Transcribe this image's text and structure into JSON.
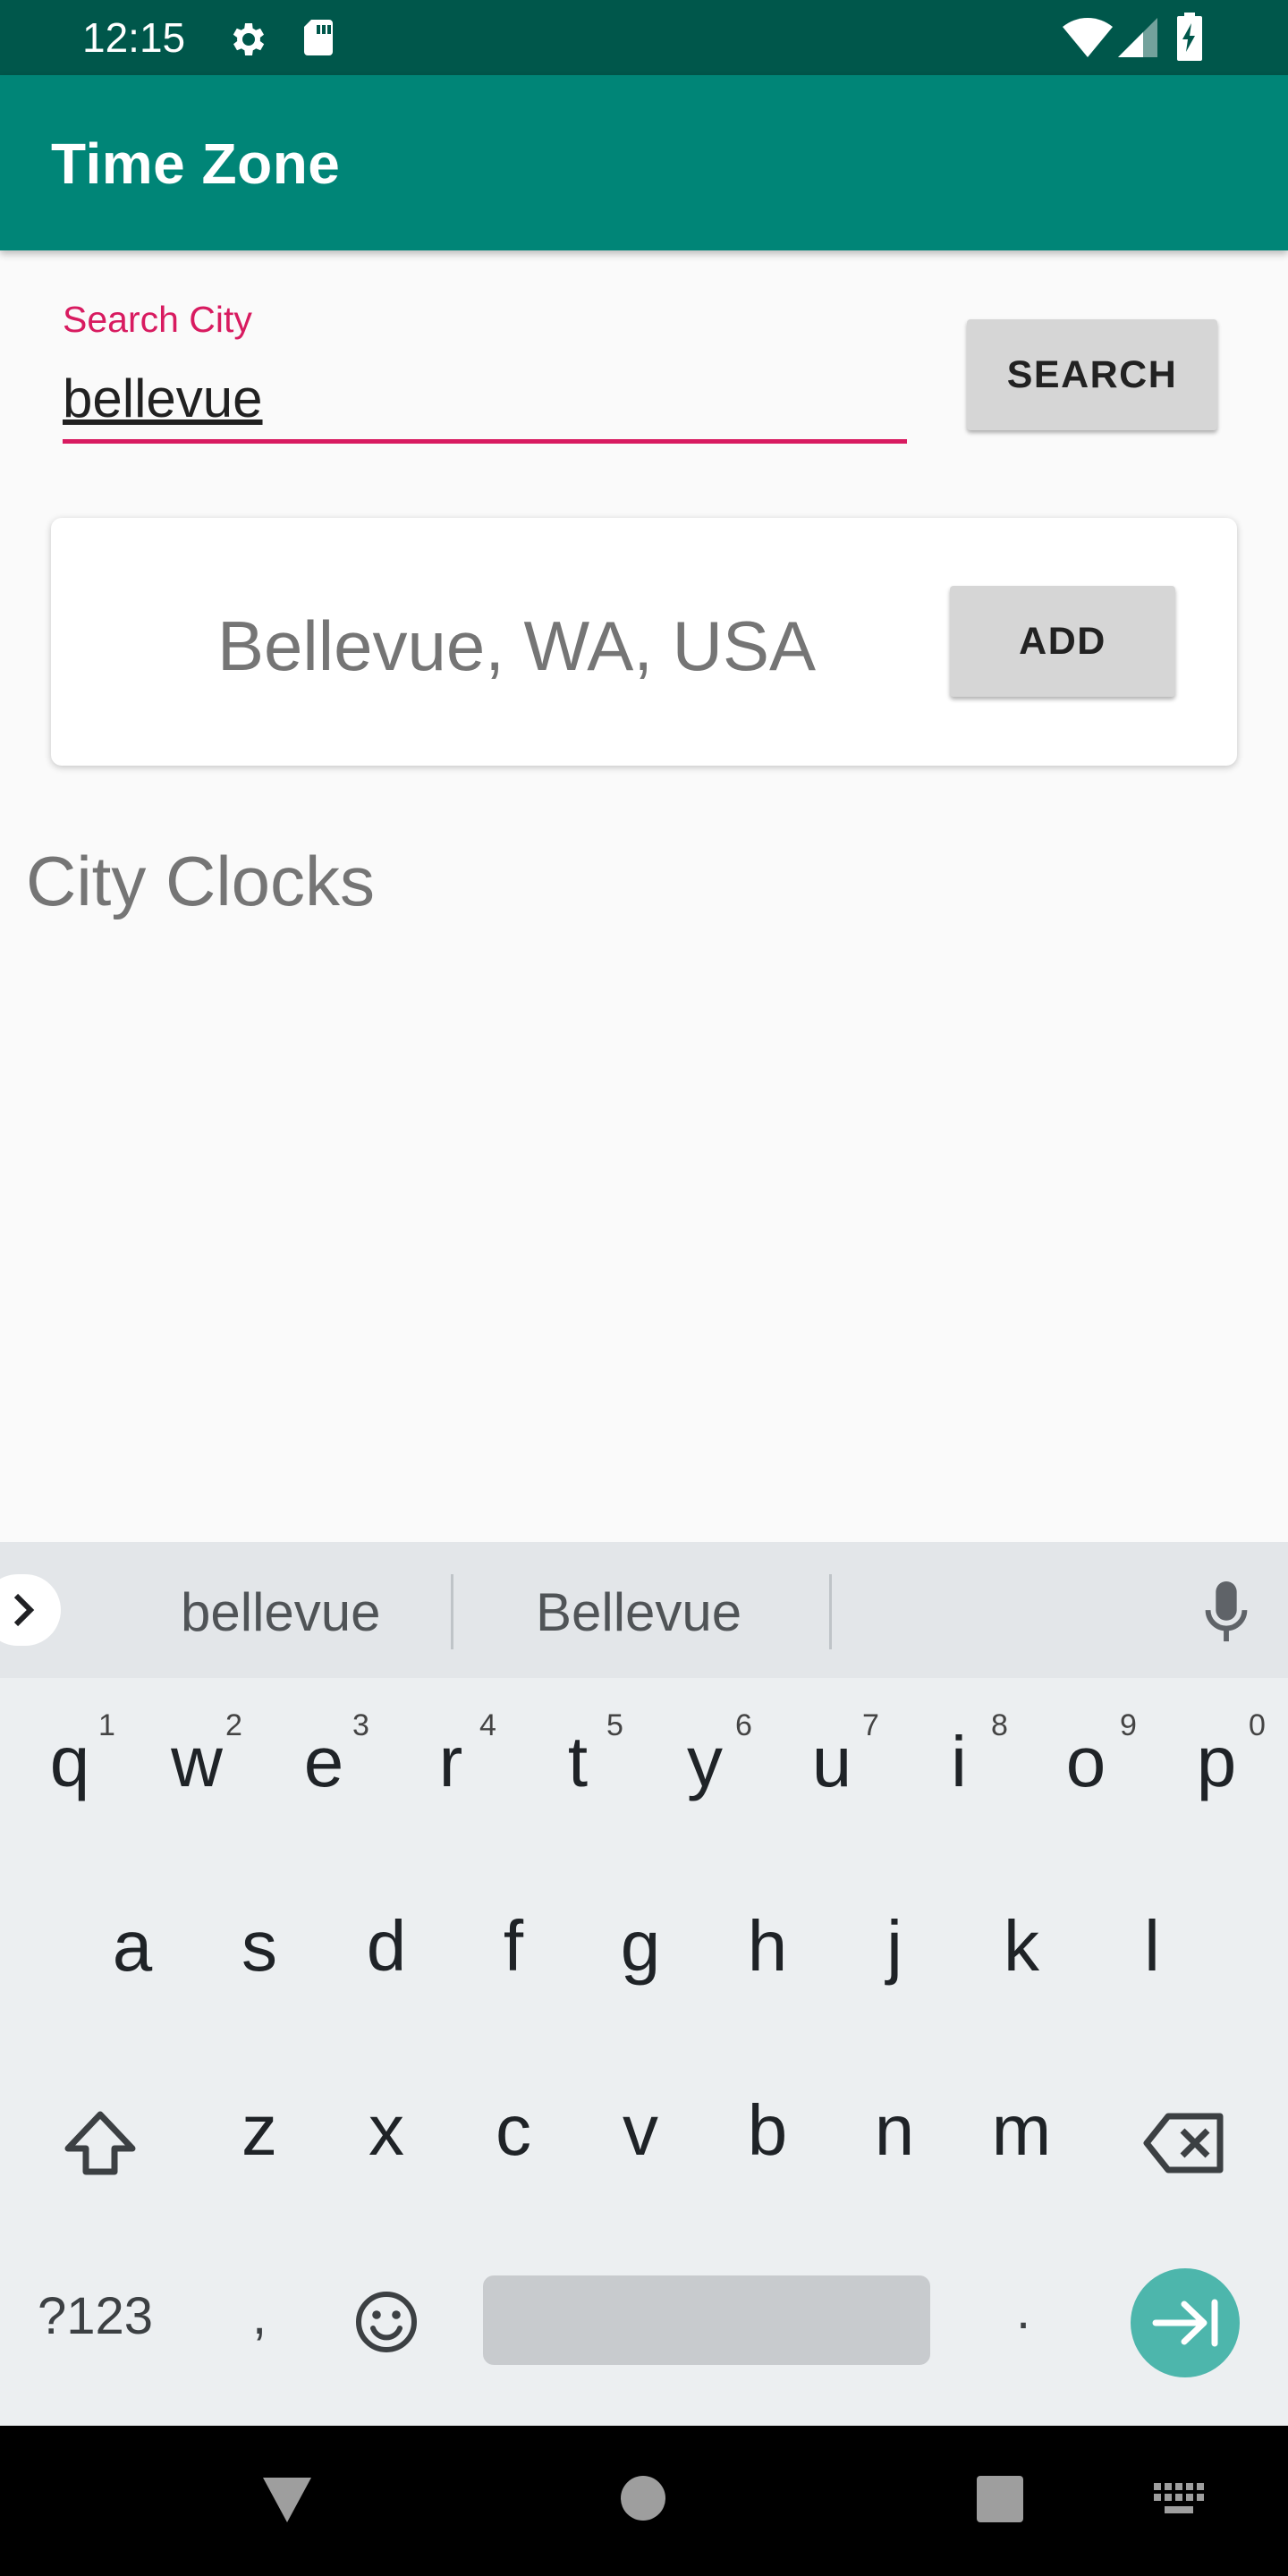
{
  "status_bar": {
    "time": "12:15",
    "icons": [
      "gear-icon",
      "sd-card-icon",
      "wifi-icon",
      "signal-icon",
      "battery-charging-icon"
    ]
  },
  "app_bar": {
    "title": "Time Zone"
  },
  "search": {
    "label": "Search City",
    "value": "bellevue",
    "button_label": "SEARCH"
  },
  "result": {
    "city": "Bellevue, WA, USA",
    "add_label": "ADD"
  },
  "section": {
    "title": "City Clocks"
  },
  "keyboard": {
    "suggestions": [
      "bellevue",
      "Bellevue"
    ],
    "row1": [
      "q",
      "w",
      "e",
      "r",
      "t",
      "y",
      "u",
      "i",
      "o",
      "p"
    ],
    "row1_hints": [
      "1",
      "2",
      "3",
      "4",
      "5",
      "6",
      "7",
      "8",
      "9",
      "0"
    ],
    "row2": [
      "a",
      "s",
      "d",
      "f",
      "g",
      "h",
      "j",
      "k",
      "l"
    ],
    "row3": [
      "z",
      "x",
      "c",
      "v",
      "b",
      "n",
      "m"
    ],
    "bottom": {
      "symbols": "?123",
      "comma": ",",
      "period": "."
    }
  },
  "colors": {
    "status_bar": "#00574b",
    "app_bar": "#008577",
    "accent": "#d81b60",
    "enter_key": "#4db6ac"
  }
}
